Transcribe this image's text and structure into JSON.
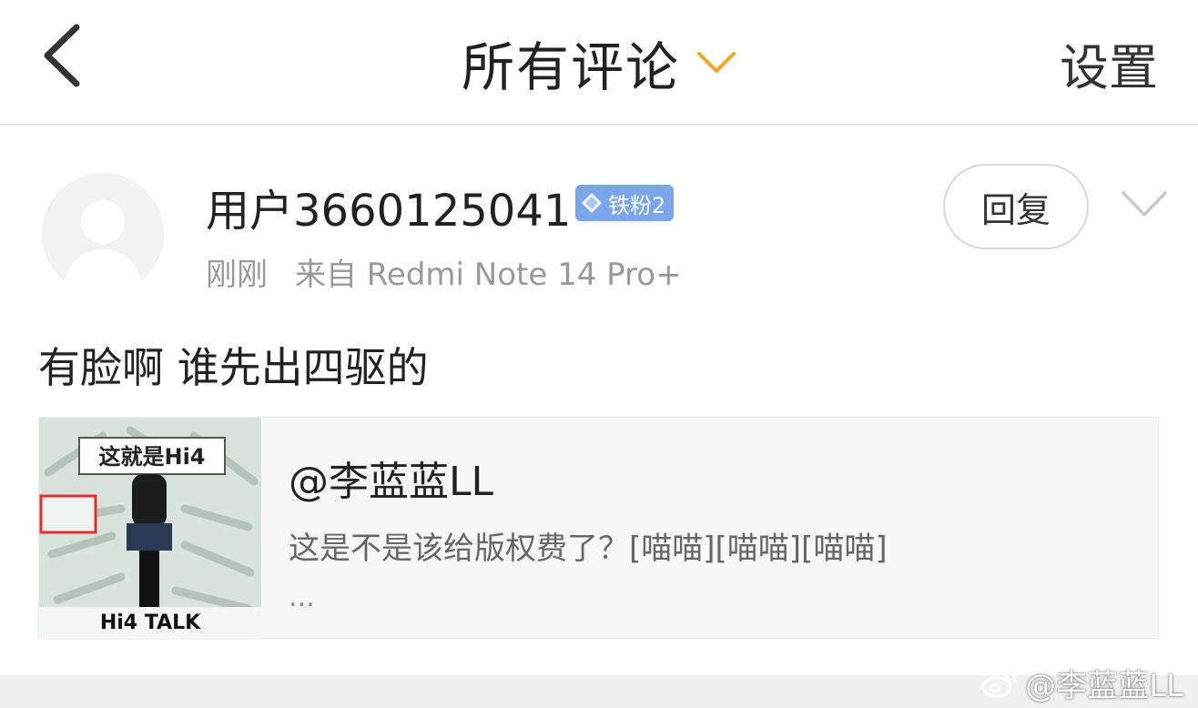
{
  "header": {
    "title": "所有评论",
    "settings_label": "设置",
    "accent_color": "#f5a623"
  },
  "comment": {
    "username": "用户3660125041",
    "badge": "铁粉2",
    "time": "刚刚",
    "source": "来自 Redmi Note 14 Pro+",
    "reply_label": "回复",
    "text": "有脸啊 谁先出四驱的"
  },
  "quote": {
    "author": "@李蓝蓝LL",
    "text": "这是不是该给版权费了？[喵喵][喵喵][喵喵]",
    "ellipsis": "...",
    "thumbnail": {
      "headline": "这就是Hi4",
      "footer": "Hi4 TALK"
    }
  },
  "watermark": {
    "text": "@李蓝蓝LL"
  }
}
